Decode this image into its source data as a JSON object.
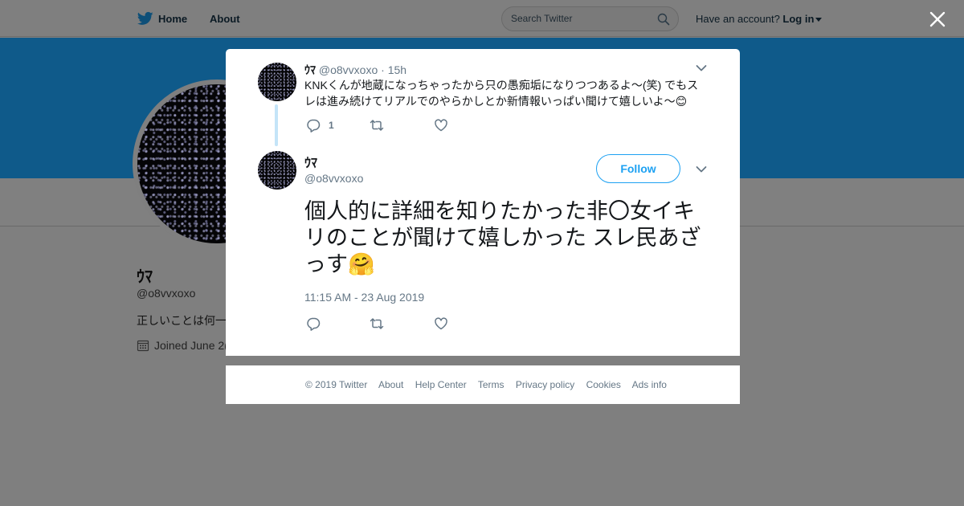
{
  "nav": {
    "home": "Home",
    "about": "About",
    "search_placeholder": "Search Twitter",
    "account_prompt": "Have an account?",
    "login": "Log in"
  },
  "profile": {
    "name": "ｳﾏ",
    "handle": "@o8vvxoxo",
    "bio": "正しいことは何一",
    "joined": "Joined June 2("
  },
  "parent_tweet": {
    "name": "ｳﾏ",
    "handle": "@o8vvxoxo",
    "separator": "·",
    "time": "15h",
    "text": "KNKくんが地蔵になっちゃったから只の愚痴垢になりつつあるよ〜(笑) でもスレは進み続けてリアルでのやらかしとか新情報いっぱい聞けて嬉しいよ〜😊",
    "reply_count": "1"
  },
  "main_tweet": {
    "name": "ｳﾏ",
    "handle": "@o8vvxoxo",
    "follow_label": "Follow",
    "text": "個人的に詳細を知りたかった非〇女イキリのことが聞けて嬉しかった スレ民あざっす🤗",
    "timestamp": "11:15 AM - 23 Aug 2019"
  },
  "footer": {
    "copyright": "© 2019 Twitter",
    "about": "About",
    "help": "Help Center",
    "terms": "Terms",
    "privacy": "Privacy policy",
    "cookies": "Cookies",
    "ads": "Ads info"
  },
  "colors": {
    "accent": "#1da1f2",
    "overlay": "#7f7f7f",
    "banner": "#0f5a8a",
    "secondary_text": "#657786"
  },
  "icons": [
    "twitter-bird-icon",
    "search-icon",
    "close-icon",
    "chevron-down-icon",
    "reply-icon",
    "retweet-icon",
    "like-icon",
    "calendar-icon"
  ]
}
